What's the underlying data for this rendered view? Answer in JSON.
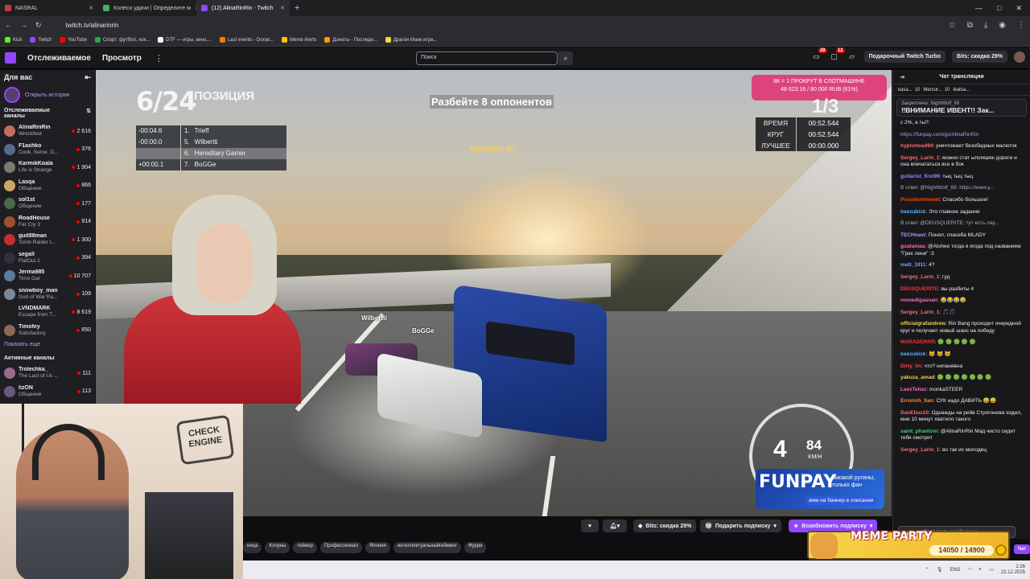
{
  "browser": {
    "tabs": [
      {
        "title": "NASRAL",
        "color": "#c93b3b",
        "active": false
      },
      {
        "title": "Колесо удачи | Определите м",
        "color": "#3bb56b",
        "active": false
      },
      {
        "title": "(12) AlinaRinRin - Twitch",
        "color": "#9146ff",
        "active": true
      }
    ],
    "new_tab": "+",
    "url": "twitch.tv/alinarinrin",
    "bookmarks": [
      {
        "label": "Kick",
        "color": "#53fc18"
      },
      {
        "label": "Twitch",
        "color": "#9146ff"
      },
      {
        "label": "YouTube",
        "color": "#ff0000"
      },
      {
        "label": "Спорт: футбол, хок...",
        "color": "#2ba84a"
      },
      {
        "label": "DTF — игры, кино,...",
        "color": "#ffffff"
      },
      {
        "label": "Last events - Donat...",
        "color": "#ff7a00"
      },
      {
        "label": "Meme Alerts",
        "color": "#f7c600"
      },
      {
        "label": "Донаты - Последн...",
        "color": "#ff9900"
      },
      {
        "label": "Драгон Манк игра...",
        "color": "#f7d44a"
      }
    ]
  },
  "twitch_nav": {
    "following": "Отслеживаемое",
    "browse": "Просмотр",
    "search_placeholder": "Поиск",
    "notif_count_1": "28",
    "notif_count_2": "12",
    "gift_turbo": "Подарочный Twitch Turbo",
    "bits_sale": "Bits: скидка 29%"
  },
  "sidebar": {
    "title": "Для вас",
    "story_link": "Открыть истории",
    "followed_title": "Отслеживаемые каналы",
    "channels": [
      {
        "name": "AlinaRinRin",
        "game": "Wreckfest",
        "viewers": "2 616",
        "color": "#c07060"
      },
      {
        "name": "F1ashko",
        "game": "Cook, Serve, D...",
        "viewers": "376",
        "color": "#556b8c"
      },
      {
        "name": "KarmikKoala",
        "game": "Life is Strange",
        "viewers": "1 904",
        "color": "#7a7a70"
      },
      {
        "name": "Lasqa",
        "game": "Общение",
        "viewers": "866",
        "color": "#c9a860"
      },
      {
        "name": "sol1st",
        "game": "Общение",
        "viewers": "177",
        "color": "#4c6a4c"
      },
      {
        "name": "RoadHouse",
        "game": "Far Cry 3",
        "viewers": "914",
        "color": "#a05030"
      },
      {
        "name": "guit88man",
        "game": "Tomb Raider I...",
        "viewers": "1 300",
        "color": "#c03030"
      },
      {
        "name": "segall",
        "game": "FlatOut 2",
        "viewers": "394",
        "color": "#303040"
      },
      {
        "name": "Jerma985",
        "game": "Time Gal",
        "viewers": "10 707",
        "color": "#5a7a9a"
      },
      {
        "name": "snowboy_man",
        "game": "God of War Ra...",
        "viewers": "109",
        "color": "#7a8a9a"
      },
      {
        "name": "LVNDMARK",
        "game": "Escape from T...",
        "viewers": "8 619",
        "color": "#202020"
      },
      {
        "name": "Timofey",
        "game": "Satisfactory",
        "viewers": "650",
        "color": "#8a6a5a"
      }
    ],
    "show_more": "Показать еще",
    "active_title": "Активные каналы",
    "active_channels": [
      {
        "name": "Trolechka_",
        "game": "The Last of Us ...",
        "viewers": "111",
        "color": "#9a6a8a"
      },
      {
        "name": "lizON",
        "game": "Общение",
        "viewers": "113",
        "color": "#6a5a7a"
      }
    ]
  },
  "game_hud": {
    "position": "6/24",
    "position_label": "ПОЗИЦИЯ",
    "leaderboard": [
      {
        "delta": "-00:04.6",
        "place": "1.",
        "name": "Trieff",
        "me": false
      },
      {
        "delta": "-00:00.0",
        "place": "5.",
        "name": "Wilbertti",
        "me": false
      },
      {
        "delta": "",
        "place": "6.",
        "name": "Hereditary Gamer",
        "me": true
      },
      {
        "delta": "+00:00.1",
        "place": "7.",
        "name": "BoGGe",
        "me": false
      }
    ],
    "objective": "Разбейте 8 оппонентов",
    "maneuvers": "МАНЕВРЫ 10",
    "slot_line1": "8К = 1 ПРОКРУТ В СЛОТМАШИНЕ",
    "slot_line2": "48 623.16 / 80 000 RUB (61%)",
    "lap": "1/3",
    "times": [
      {
        "label": "ВРЕМЯ",
        "value": "00:52.544"
      },
      {
        "label": "КРУГ",
        "value": "00:52.544"
      },
      {
        "label": "ЛУЧШЕЕ",
        "value": "00:00.000"
      }
    ],
    "tag_wilbertti": "Wilbertti",
    "tag_bogge": "BoGGe",
    "gear": "4",
    "speed": "84",
    "speed_unit": "KM/H",
    "funpay_brand": "FUNPAY",
    "funpay_text1": "никакой рутины,",
    "funpay_text2": "только фан",
    "funpay_cta": "жми на баннер в описании"
  },
  "controls": {
    "bits": "Bits: скидка 29%",
    "gift_sub": "Подарить подписку",
    "renew_sub": "Возобновить подписку",
    "tags": [
      "ница",
      "Клоуны",
      "геймер",
      "Профессионал",
      "Япония",
      "интеллектуальныйгейминг",
      "Фурри"
    ]
  },
  "chat": {
    "title": "Чат трансляции",
    "gifters": [
      {
        "name": "kasa...",
        "count": "10"
      },
      {
        "name": "Mercur...",
        "count": "10"
      },
      {
        "name": "ikatsa...",
        "count": ""
      }
    ],
    "pinned_by": "Закреплено: NightWolf_69",
    "pinned_text": "‼ВНИМАНИЕ ИВЕНТ!! Зак...",
    "messages": [
      {
        "user": "",
        "color": "#efeff1",
        "text": "с 2%, а ты?:"
      },
      {
        "user": "",
        "color": "#bf94ff",
        "text": "https://funpay.com/go/AlinaRinRin"
      },
      {
        "user": "hypnotoad94",
        "color": "#ff6b6b",
        "text": "уничтожает безобидных малюток"
      },
      {
        "user": "Sergey_Larin_1",
        "color": "#ff6b6b",
        "text": "можно стат ыпоперек дороги и она впечататься все в бок"
      },
      {
        "user": "guitarist_first99",
        "color": "#b07aff",
        "text": "тыц тыц тыц"
      },
      {
        "user": "",
        "color": "#adadb8",
        "text": "В ответ @NightWolf_69: https://www.y..."
      },
      {
        "user": "Presidentmenet",
        "color": "#ff4500",
        "text": "Спасибо большое!"
      },
      {
        "user": "beezubick",
        "color": "#5ab0ff",
        "text": "Это главное задание"
      },
      {
        "user": "",
        "color": "#adadb8",
        "text": "В ответ @DEUSQUERITE: тут есть пау..."
      },
      {
        "user": "TECHnavt",
        "color": "#a0a0ff",
        "text": "Понял, спасеба MLADY"
      },
      {
        "user": "guatamaa",
        "color": "#ff69b4",
        "text": "@Atohee тогда я ягода под названием \"Грех лени\" :3"
      },
      {
        "user": "matt_1911",
        "color": "#7aa0ff",
        "text": "4?"
      },
      {
        "user": "Sergey_Larin_1",
        "color": "#ff6b6b",
        "text": "гуд"
      },
      {
        "user": "DEUSQUERITE",
        "color": "#ff3030",
        "text": "вы разбиты 4"
      },
      {
        "user": "nomedigasnan",
        "color": "#ff69b4",
        "text": "😂😂😂😂"
      },
      {
        "user": "Sergey_Larin_1",
        "color": "#ff6b6b",
        "text": "🎵🎵"
      },
      {
        "user": "officialgrafandrew",
        "color": "#f5d142",
        "text": "Rin Bang проходит очередной круг и получает новый шанс на победу"
      },
      {
        "user": "MARADERRR",
        "color": "#ff3030",
        "text": "🟢 🟢 🟢 🟢 🟢"
      },
      {
        "user": "beezubick",
        "color": "#5ab0ff",
        "text": "😺 😺 😺"
      },
      {
        "user": "Dirty_lin",
        "color": "#ff4040",
        "text": "что? нипанявна"
      },
      {
        "user": "yakuza_amad",
        "color": "#f5d142",
        "text": "🟢 🟢 🟢 🟢 🟢 🟢 🟢"
      },
      {
        "user": "LeezTehez",
        "color": "#ff69b4",
        "text": "monkaSTEER"
      },
      {
        "user": "Errorich_San",
        "color": "#ff8c40",
        "text": "СУК надо ДАВИТЬ 😅😅"
      },
      {
        "user": "DanElius10",
        "color": "#ff6b6b",
        "text": "Однажды на рейв Строгонова ходил, мне 10 минут хватило такого"
      },
      {
        "user": "saint_phantom",
        "color": "#3ad16b",
        "text": "@AlinaRinRin Мад чисто сидит тебя смотрит"
      },
      {
        "user": "Sergey_Larin_1",
        "color": "#ff6b6b",
        "text": "во так их молодец"
      }
    ],
    "input_placeholder": "Отправить сообщение",
    "send": "Чат"
  },
  "webcam": {
    "sign_line1": "CHECK",
    "sign_line2": "ENGINE"
  },
  "meme_party": {
    "title": "MEME PARTY",
    "progress": "14050 / 14900"
  },
  "taskbar": {
    "lang": "ENG",
    "time": "2:26",
    "date": "22.12.2025"
  }
}
